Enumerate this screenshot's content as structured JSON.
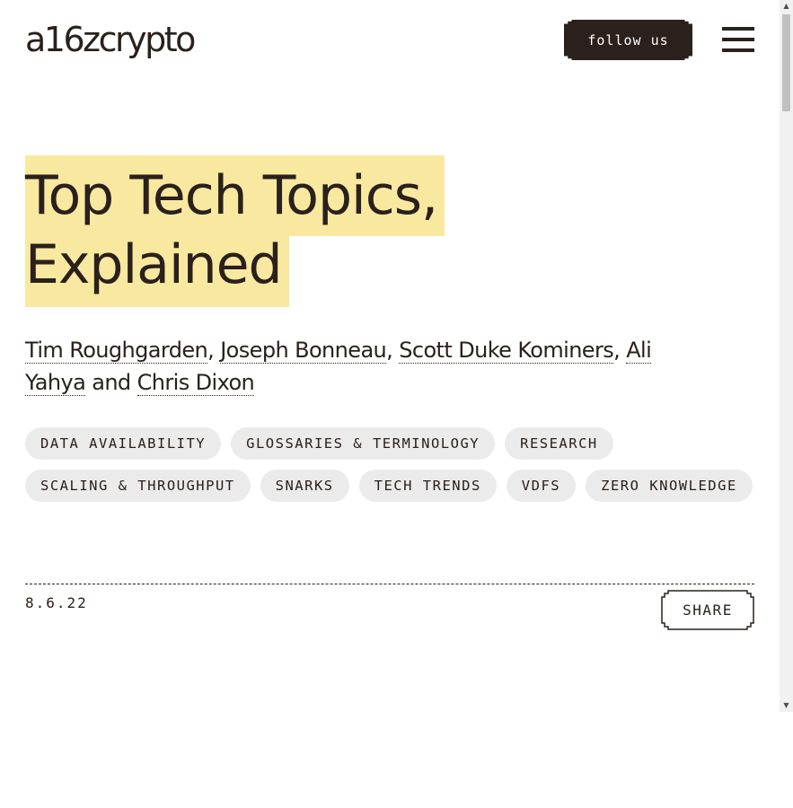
{
  "header": {
    "logo_text": "a16zcrypto",
    "follow_label": "follow us",
    "menu_icon": "hamburger-menu-icon"
  },
  "article": {
    "title_line1": "Top Tech Topics,",
    "title_line2": "Explained",
    "authors": [
      "Tim Roughgarden",
      "Joseph Bonneau",
      "Scott Duke Kominers",
      "Ali Yahya",
      "Chris Dixon"
    ],
    "author_separator": ", ",
    "author_conjunction": " and ",
    "tags_row1": [
      "DATA AVAILABILITY",
      "GLOSSARIES & TERMINOLOGY",
      "RESEARCH"
    ],
    "tags_row2": [
      "SCALING & THROUGHPUT",
      "SNARKS",
      "TECH TRENDS",
      "VDFS",
      "ZERO KNOWLEDGE"
    ],
    "date": "8.6.22",
    "share_label": "SHARE"
  },
  "colors": {
    "ink": "#2a201c",
    "title_highlight": "#f9e9a0",
    "tag_bg": "#ebebeb"
  }
}
